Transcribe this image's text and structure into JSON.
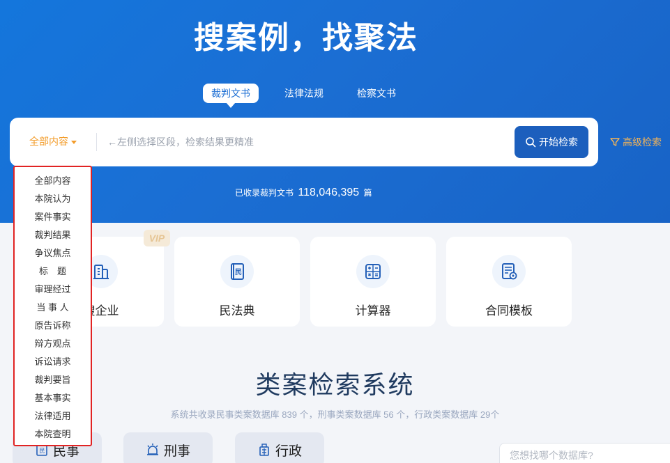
{
  "hero": {
    "title": "搜案例，找聚法",
    "tabs": [
      {
        "label": "裁判文书",
        "active": true
      },
      {
        "label": "法律法规",
        "active": false
      },
      {
        "label": "检察文书",
        "active": false
      }
    ]
  },
  "search": {
    "scope_label": "全部内容",
    "placeholder": "←左侧选择区段，检索结果更精准",
    "button_label": "开始检索",
    "advanced_label": "高级检索"
  },
  "stats": {
    "prefix": "已收录裁判文书",
    "count": "118,046,395",
    "suffix": "篇"
  },
  "scope_dropdown": {
    "items": [
      "全部内容",
      "本院认为",
      "案件事实",
      "裁判结果",
      "争议焦点",
      "标　题",
      "审理经过",
      "当 事 人",
      "原告诉称",
      "辩方观点",
      "诉讼请求",
      "裁判要旨",
      "基本事实",
      "法律适用",
      "本院查明"
    ]
  },
  "cards": [
    {
      "label": "搜企业",
      "icon": "building-icon",
      "vip": "VIP"
    },
    {
      "label": "民法典",
      "icon": "civil-code-icon"
    },
    {
      "label": "计算器",
      "icon": "calculator-icon"
    },
    {
      "label": "合同模板",
      "icon": "contract-template-icon"
    }
  ],
  "section": {
    "title": "类案检索系统",
    "subtitle": "系统共收录民事类案数据库 839 个，刑事类案数据库 56 个，行政类案数据库 29个"
  },
  "categories": [
    {
      "label": "民事",
      "icon": "civil-icon"
    },
    {
      "label": "刑事",
      "icon": "criminal-icon"
    },
    {
      "label": "行政",
      "icon": "administrative-icon"
    }
  ],
  "db_search": {
    "placeholder": "您想找哪个数据库?"
  },
  "colors": {
    "hero_blue": "#1a6dd3",
    "search_button": "#1c5fbd",
    "scope_orange": "#f39c2a",
    "advanced_gold": "#f3b458",
    "dropdown_border": "#e12323"
  }
}
